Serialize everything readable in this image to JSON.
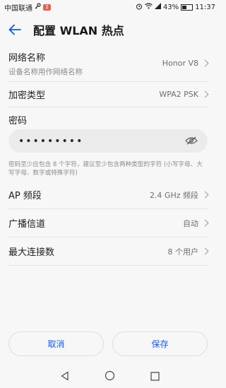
{
  "status": {
    "carrier": "中国联通",
    "badge": "2",
    "battery": "43%",
    "battery_level": 0.43,
    "time": "11:37"
  },
  "header": {
    "title": "配置 WLAN 热点"
  },
  "network_name": {
    "label": "网络名称",
    "sub": "设备名称用作网络名称",
    "value": "Honor V8"
  },
  "encryption": {
    "label": "加密类型",
    "value": "WPA2 PSK"
  },
  "password": {
    "label": "密码",
    "value": "•••••••••",
    "hint": "密码至少应包含 8 个字符，建议至少包含两种类型的字符 (小写字母、大写字母、数字或特殊字符)"
  },
  "band": {
    "label": "AP 频段",
    "value": "2.4 GHz 频段"
  },
  "channel": {
    "label": "广播信道",
    "value": "自动"
  },
  "max_conn": {
    "label": "最大连接数",
    "value": "8 个用户"
  },
  "buttons": {
    "cancel": "取消",
    "save": "保存"
  },
  "colors": {
    "accent": "#0a59f7",
    "background": "#f7f7f7"
  }
}
